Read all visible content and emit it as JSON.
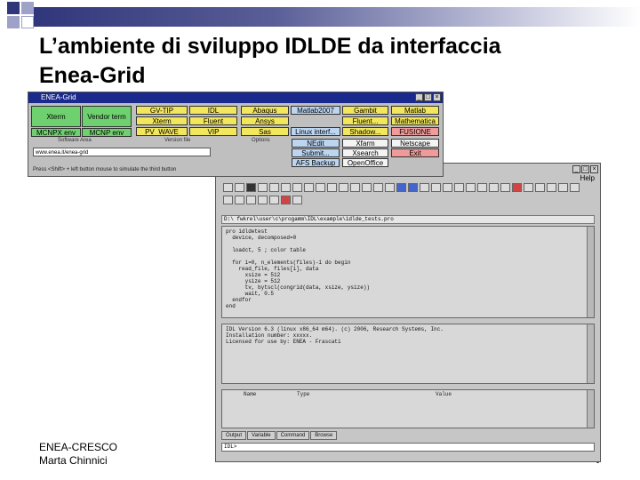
{
  "slide": {
    "title_line1": "L’ambiente di sviluppo IDLDE da interfaccia",
    "title_line2": "Enea-Grid",
    "footer_line1": "ENEA-CRESCO",
    "footer_line2": "Marta Chinnici",
    "page_number": "4"
  },
  "colors": {
    "accent_square_dark": "#30367a",
    "accent_square_light": "#9ea2c8",
    "title_bar_gradient_start": "#30367a"
  },
  "launcher": {
    "window_title": "ENEA-Grid",
    "buttons": [
      {
        "label": "Xterm",
        "color": "green"
      },
      {
        "label": "Vendor term",
        "color": "green"
      },
      {
        "label": "MCNPX env",
        "color": "green"
      },
      {
        "label": "MCNP env",
        "color": "green"
      },
      {
        "label": "GV-TIP",
        "color": "yellow"
      },
      {
        "label": "Xterm",
        "color": "yellow"
      },
      {
        "label": "PV_WAVE",
        "color": "yellow"
      },
      {
        "label": "IDL",
        "color": "yellow"
      },
      {
        "label": "Fluent",
        "color": "yellow"
      },
      {
        "label": "VIP",
        "color": "yellow"
      },
      {
        "label": "Abaqus",
        "color": "yellow"
      },
      {
        "label": "Ansys",
        "color": "yellow"
      },
      {
        "label": "Sas",
        "color": "yellow"
      },
      {
        "label": "Matlab2007",
        "color": "blue"
      },
      {
        "label": "Linux interf...",
        "color": "blue"
      },
      {
        "label": "Gambit",
        "color": "yellow"
      },
      {
        "label": "Fluent...",
        "color": "yellow"
      },
      {
        "label": "Shadow...",
        "color": "yellow"
      },
      {
        "label": "Matlab",
        "color": "yellow"
      },
      {
        "label": "Mathematica",
        "color": "yellow"
      },
      {
        "label": "FUSIONE",
        "color": "pink"
      },
      {
        "label": "NEdit",
        "color": "blue"
      },
      {
        "label": "Submit...",
        "color": "blue"
      },
      {
        "label": "AFS Backup",
        "color": "blue"
      },
      {
        "label": "Xfarm",
        "color": "white"
      },
      {
        "label": "Xsearch",
        "color": "white"
      },
      {
        "label": "OpenOffice",
        "color": "white"
      },
      {
        "label": "Netscape",
        "color": "white"
      },
      {
        "label": "Exit",
        "color": "pink"
      }
    ],
    "label_a": "Software Area",
    "label_b": "Version file",
    "label_c": "Options",
    "field_value": "www.enea.it/enea-grid",
    "hint": "Press <Shift> + left button mouse to simulate the third button"
  },
  "idlde": {
    "help_label": "Help",
    "path_text": "D:\\ fwkrel\\user\\c\\progamm\\IDL\\example\\idlde_tests.pro",
    "editor_lines": [
      "pro idldetest",
      "  device, decomposed=0",
      "",
      "  loadct, 5 ; color table",
      "",
      "  for i=0, n_elements(files)-1 do begin",
      "    read_file, files[i], data",
      "      xsize = 512",
      "      ysize = 512",
      "      tv, bytscl(congrid(data, xsize, ysize))",
      "      wait, 0.5",
      "  endfor",
      "end"
    ],
    "output_lines": [
      "IDL Version 6.3 (linux x86_64 m64). (c) 2006, Research Systems, Inc.",
      "Installation number: xxxxx.",
      "Licensed for use by: ENEA - Frascati"
    ],
    "var_header_name": "Name",
    "var_header_type": "Type",
    "var_header_value": "Value",
    "tabs": [
      "Output",
      "Variable",
      "Command",
      "Browse"
    ],
    "command_prompt": "IDL>"
  }
}
